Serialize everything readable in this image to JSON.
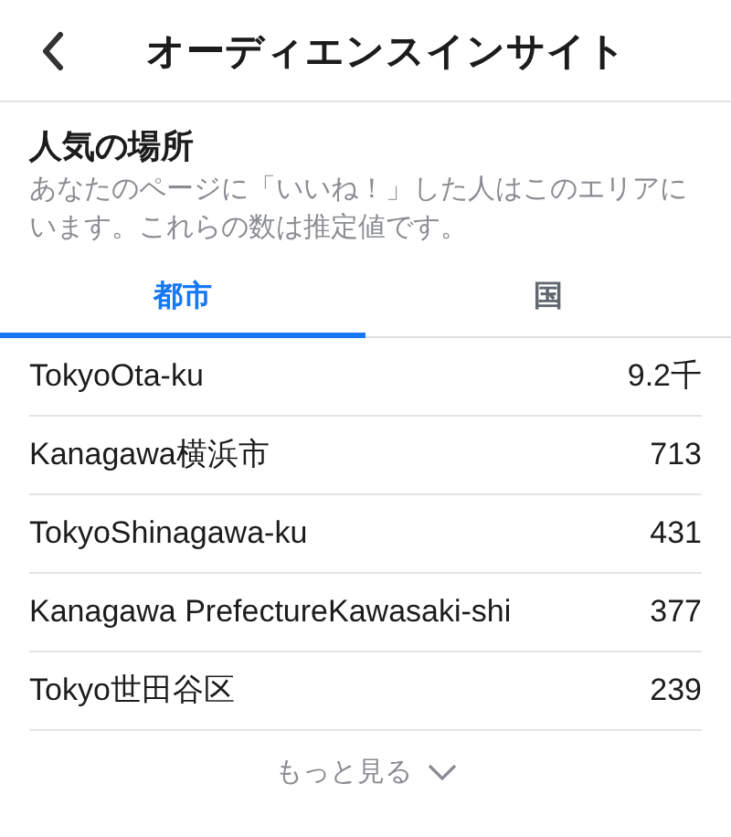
{
  "header": {
    "title": "オーディエンスインサイト"
  },
  "section": {
    "title": "人気の場所",
    "description": "あなたのページに「いいね！」した人はこのエリアにいます。これらの数は推定値です。"
  },
  "tabs": [
    {
      "label": "都市",
      "selected": true
    },
    {
      "label": "国",
      "selected": false
    }
  ],
  "rows": [
    {
      "place": "TokyoOta-ku",
      "count": "9.2千"
    },
    {
      "place": "Kanagawa横浜市",
      "count": "713"
    },
    {
      "place": "TokyoShinagawa-ku",
      "count": "431"
    },
    {
      "place": "Kanagawa PrefectureKawasaki-shi",
      "count": "377"
    },
    {
      "place": "Tokyo世田谷区",
      "count": "239"
    }
  ],
  "more": {
    "label": "もっと見る"
  }
}
